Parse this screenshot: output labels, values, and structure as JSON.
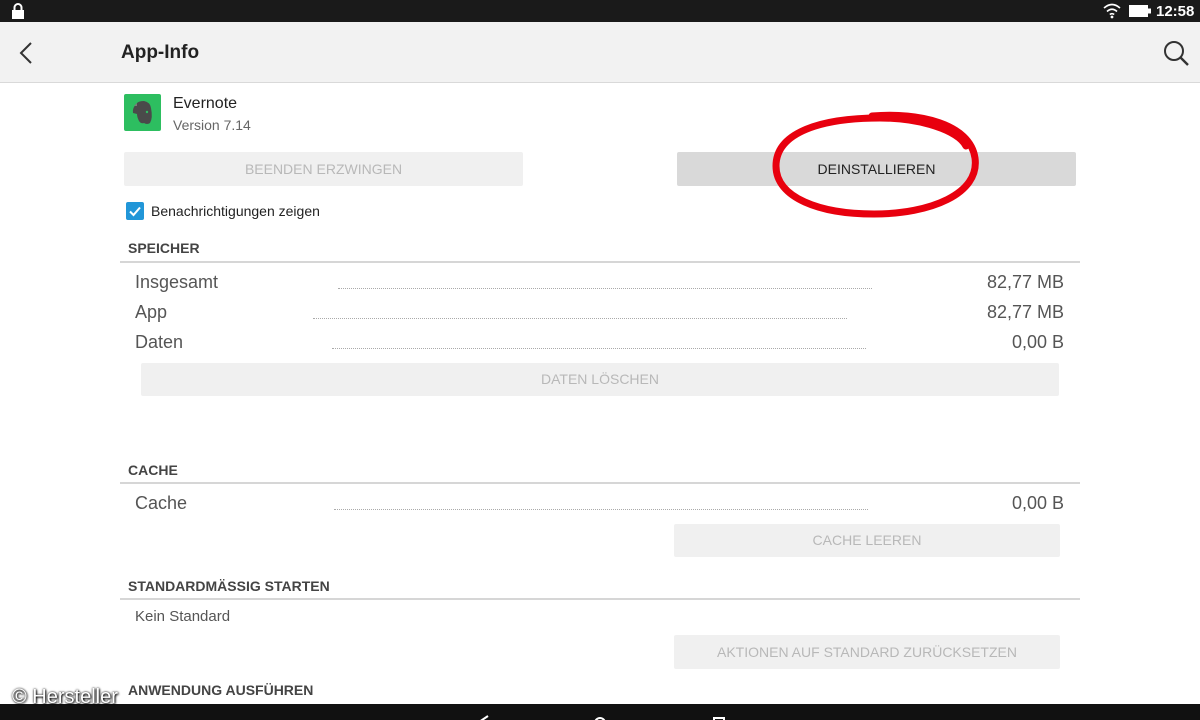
{
  "status_bar": {
    "time": "12:58"
  },
  "app_bar": {
    "title": "App-Info"
  },
  "app": {
    "name": "Evernote",
    "version": "Version 7.14",
    "accent_color": "#2dbe60"
  },
  "buttons": {
    "force_stop": "BEENDEN ERZWINGEN",
    "uninstall": "DEINSTALLIEREN",
    "clear_data": "DATEN LÖSCHEN",
    "clear_cache": "CACHE LEEREN",
    "reset_defaults": "AKTIONEN AUF STANDARD ZURÜCKSETZEN"
  },
  "notifications": {
    "label": "Benachrichtigungen zeigen",
    "checked": true,
    "color": "#2196d8"
  },
  "storage": {
    "header": "SPEICHER",
    "rows": [
      {
        "label": "Insgesamt",
        "value": "82,77 MB"
      },
      {
        "label": "App",
        "value": "82,77 MB"
      },
      {
        "label": "Daten",
        "value": "0,00 B"
      }
    ]
  },
  "cache": {
    "header": "CACHE",
    "rows": [
      {
        "label": "Cache",
        "value": "0,00 B"
      }
    ]
  },
  "default_launch": {
    "header": "STANDARDMÄSSIG STARTEN",
    "text": "Kein Standard"
  },
  "run_app": {
    "header": "ANWENDUNG AUSFÜHREN"
  },
  "watermark": "© Hersteller",
  "highlight_color": "#e8000e"
}
